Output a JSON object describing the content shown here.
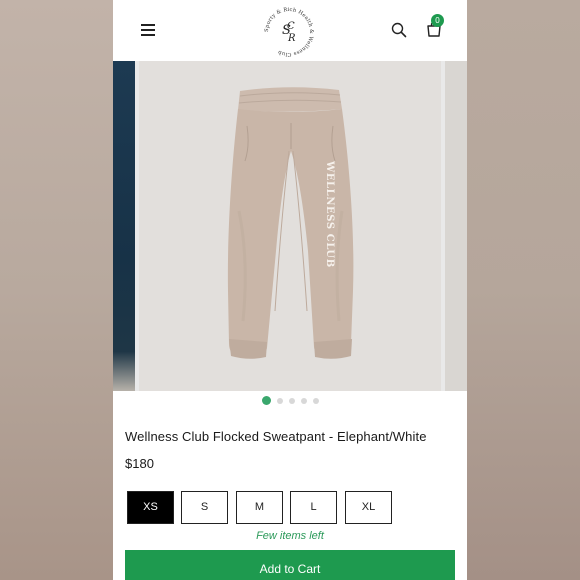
{
  "header": {
    "logo_monogram": "SRC",
    "logo_ring_text": "Sporty & Rich Health & Wellness Club",
    "cart_count": "0"
  },
  "carousel": {
    "graphic_text": "WELLNESS CLUB",
    "slide_count": 5,
    "active_slide": 1
  },
  "product": {
    "title": "Wellness Club Flocked Sweatpant - Elephant/White",
    "price": "$180",
    "sizes": [
      "XS",
      "S",
      "M",
      "L",
      "XL"
    ],
    "selected_size": "XS",
    "stock_note": "Few items left",
    "add_to_cart_label": "Add to Cart"
  },
  "colors": {
    "accent_green": "#1e9a4f",
    "pant_color": "#c9b6a8",
    "background_blur": "#b4a59a"
  }
}
